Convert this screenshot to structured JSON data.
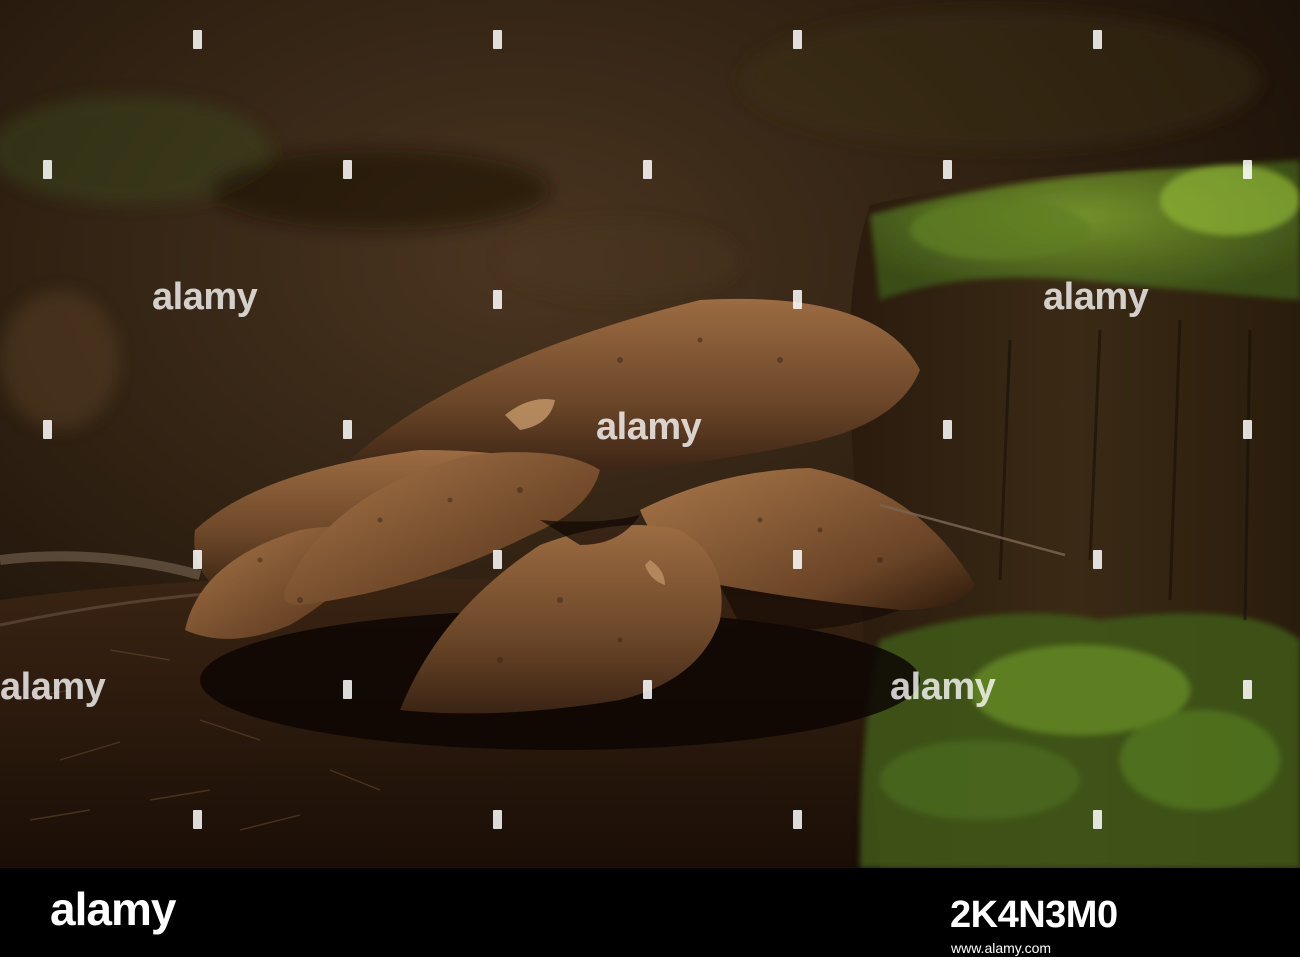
{
  "scene": {
    "subject": "mushroom-cluster",
    "palette": {
      "background": "#2c1e10",
      "moss": "#5a7a22",
      "cap": "#6b4628",
      "cap_highlight": "#a9774a",
      "shadow": "#120904"
    }
  },
  "watermark": {
    "word": "alamy"
  },
  "footer": {
    "brand": "alamy",
    "image_id": "2K4N3M0",
    "url": "www.alamy.com"
  }
}
